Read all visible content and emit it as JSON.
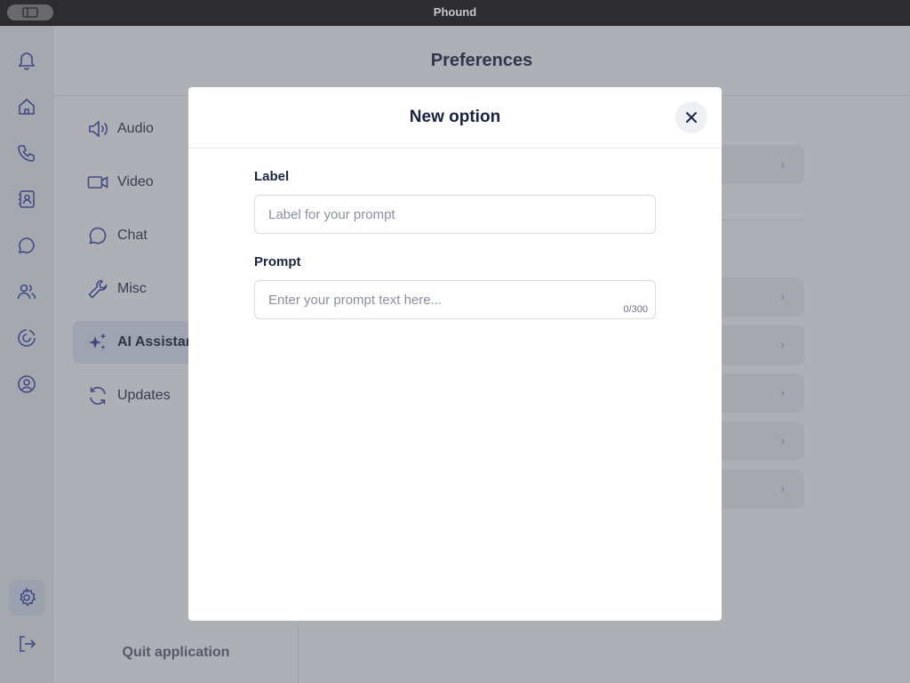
{
  "window": {
    "title": "Phound"
  },
  "rail": {
    "items": [
      {
        "icon": "bell-icon"
      },
      {
        "icon": "home-icon"
      },
      {
        "icon": "phone-icon"
      },
      {
        "icon": "contacts-icon"
      },
      {
        "icon": "chat-bubble-icon"
      },
      {
        "icon": "people-icon"
      },
      {
        "icon": "activity-icon"
      },
      {
        "icon": "profile-icon"
      },
      {
        "icon": "gear-icon",
        "active": true
      },
      {
        "icon": "logout-icon"
      }
    ]
  },
  "header": {
    "title": "Preferences"
  },
  "settings_nav": {
    "items": [
      {
        "label": "Audio",
        "icon": "speaker-icon"
      },
      {
        "label": "Video",
        "icon": "video-camera-icon"
      },
      {
        "label": "Chat",
        "icon": "chat-bubble-icon"
      },
      {
        "label": "Misc",
        "icon": "wrench-icon"
      },
      {
        "label": "AI Assistant",
        "icon": "sparkles-icon",
        "active": true
      },
      {
        "label": "Updates",
        "icon": "refresh-icon"
      }
    ],
    "quit_label": "Quit application"
  },
  "modal": {
    "title": "New option",
    "label_field": {
      "label": "Label",
      "placeholder": "Label for your prompt",
      "value": ""
    },
    "prompt_field": {
      "label": "Prompt",
      "placeholder": "Enter your prompt text here...",
      "value": "",
      "counter": "0/300"
    }
  },
  "colors": {
    "accent": "#3b45a8",
    "active_bg": "#e6e9f8",
    "overlay": "#4b505a"
  }
}
